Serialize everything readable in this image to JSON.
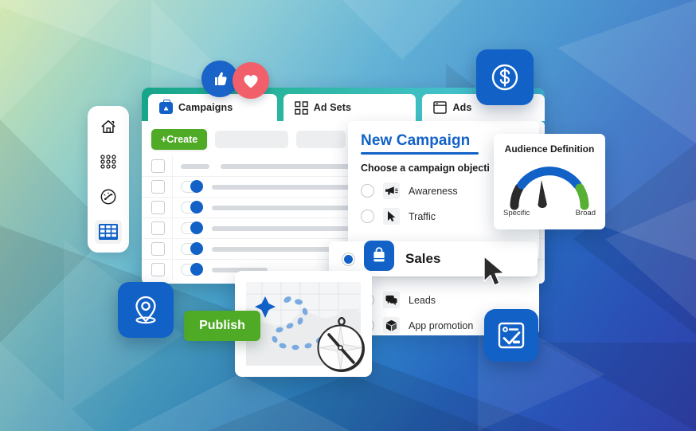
{
  "background": {
    "top_left_color": "#b9dcae",
    "mid_color": "#3f9fcb",
    "bottom_right_color": "#2b3fa8"
  },
  "sidebar": {
    "items": [
      {
        "icon": "home-icon",
        "active": false
      },
      {
        "icon": "apps-grid-icon",
        "active": false
      },
      {
        "icon": "speedometer-icon",
        "active": false
      },
      {
        "icon": "table-grid-icon",
        "active": true
      }
    ]
  },
  "window": {
    "tabs": [
      {
        "label": "Campaigns",
        "icon": "campaigns-bag-icon",
        "active": true
      },
      {
        "label": "Ad Sets",
        "icon": "adsets-grid-icon",
        "active": false
      },
      {
        "label": "Ads",
        "icon": "ads-frame-icon",
        "active": false
      }
    ],
    "toolbar": {
      "create_label": "+Create",
      "create_color": "#4faa26"
    },
    "table": {
      "rows": [
        {
          "checkbox": true,
          "toggle": false
        },
        {
          "checkbox": true,
          "toggle": true
        },
        {
          "checkbox": true,
          "toggle": true
        },
        {
          "checkbox": true,
          "toggle": true
        },
        {
          "checkbox": true,
          "toggle": true
        },
        {
          "checkbox": true,
          "toggle": true
        }
      ]
    }
  },
  "reactions": [
    {
      "name": "thumbs-up",
      "color": "#1a63c9"
    },
    {
      "name": "heart",
      "color": "#f1606a"
    }
  ],
  "new_campaign": {
    "title": "New Campaign",
    "title_color": "#1161c7",
    "subtitle": "Choose a campaign objecti",
    "objectives": [
      {
        "label": "Awareness",
        "icon": "megaphone-icon",
        "selected": false
      },
      {
        "label": "Traffic",
        "icon": "cursor-arrow-icon",
        "selected": false
      },
      {
        "label": "Sales",
        "icon": "shopping-bag-icon",
        "selected": true
      },
      {
        "label": "Leads",
        "icon": "chat-bubbles-icon",
        "selected": false
      },
      {
        "label": "App promotion",
        "icon": "cube-box-icon",
        "selected": false
      }
    ]
  },
  "audience": {
    "title": "Audience Definition",
    "left_label": "Specific",
    "right_label": "Broad",
    "gauge": {
      "needle_position": "specific",
      "arc_color": "#1161c7",
      "left_segment_color": "#2b2b2b",
      "right_segment_color": "#57b033"
    }
  },
  "map_card": {
    "icon": "map-route-card",
    "marker": "blue-star-marker",
    "compass": "compass-icon"
  },
  "publish": {
    "label": "Publish",
    "color": "#4faa26"
  },
  "badges": [
    {
      "name": "dollar-badge",
      "icon": "dollar-circle-icon",
      "color": "#1161c7"
    },
    {
      "name": "location-badge",
      "icon": "map-pin-icon",
      "color": "#1161c7"
    },
    {
      "name": "task-badge",
      "icon": "checklist-icon",
      "color": "#1161c7"
    }
  ],
  "cursor": {
    "name": "mouse-pointer"
  }
}
